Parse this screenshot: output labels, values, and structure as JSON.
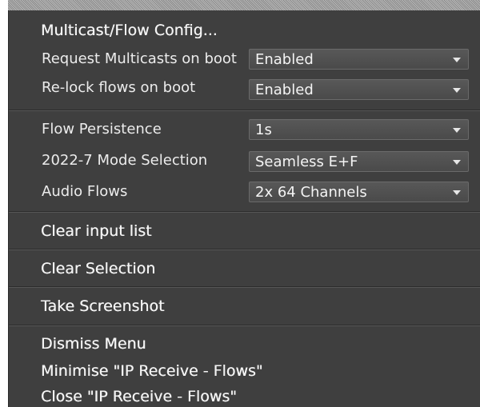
{
  "menu": {
    "header": "Multicast/Flow Config...",
    "settings_group_1": [
      {
        "label": "Request Multicasts on boot",
        "value": "Enabled"
      },
      {
        "label": "Re-lock flows on boot",
        "value": "Enabled"
      }
    ],
    "settings_group_2": [
      {
        "label": "Flow Persistence",
        "value": "1s"
      },
      {
        "label": "2022-7 Mode Selection",
        "value": "Seamless E+F"
      },
      {
        "label": "Audio Flows",
        "value": "2x 64 Channels"
      }
    ],
    "actions": {
      "clear_input_list": "Clear input list",
      "clear_selection": "Clear Selection",
      "take_screenshot": "Take Screenshot",
      "dismiss_menu": "Dismiss Menu",
      "minimise": "Minimise \"IP Receive - Flows\"",
      "close": "Close \"IP Receive - Flows\""
    },
    "icons": {
      "dropdown": "chevron-down-icon"
    },
    "colors": {
      "background": "#3f3f3f",
      "text": "#f4f4f4",
      "select_background": "#525252"
    }
  }
}
